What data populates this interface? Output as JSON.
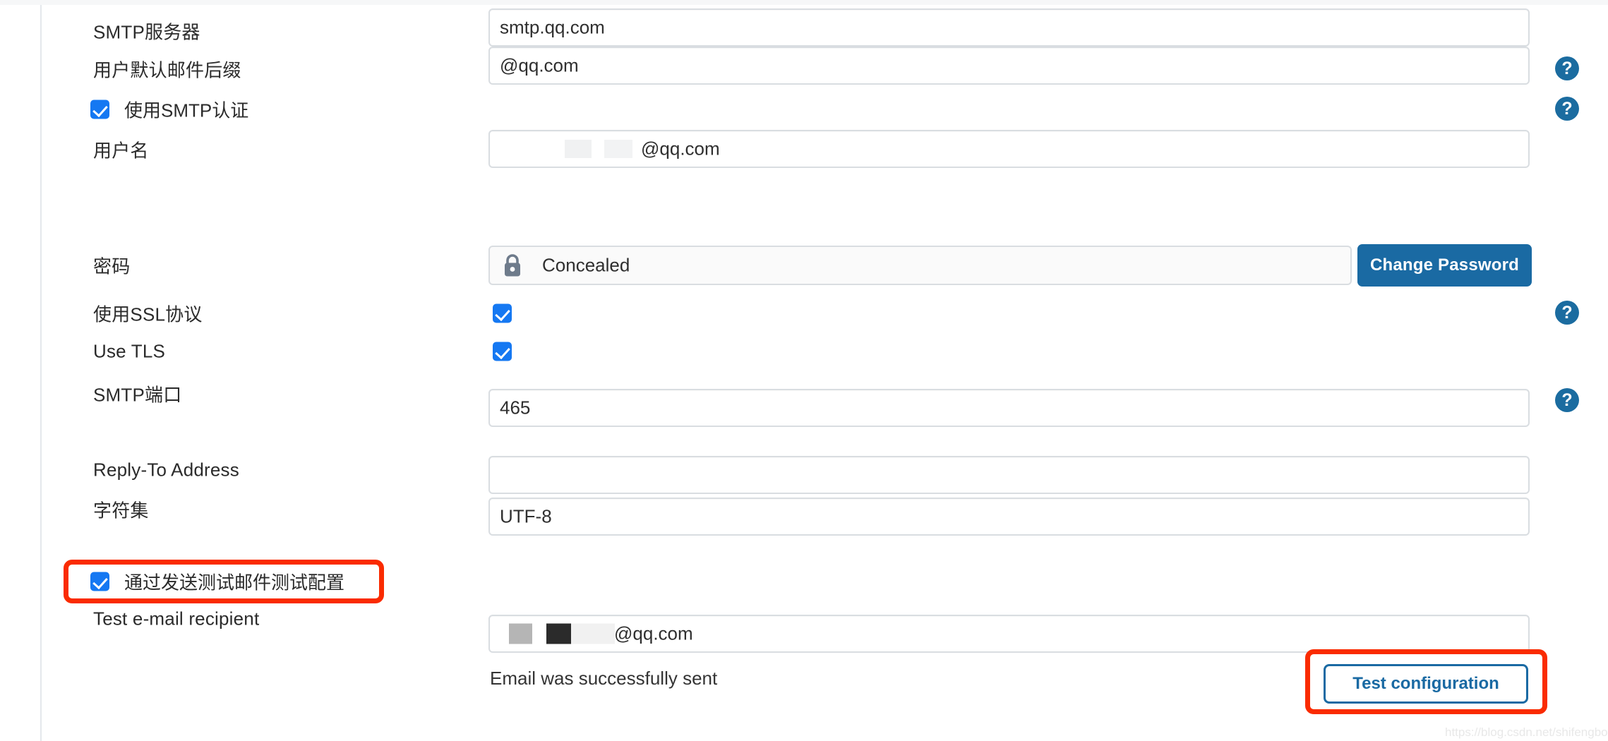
{
  "page": {
    "watermark": "https://blog.csdn.net/shifengboy"
  },
  "form": {
    "rows": [
      {
        "label": "SMTP服务器",
        "value": "smtp.qq.com"
      },
      {
        "label": "用户默认邮件后缀",
        "value": "@qq.com"
      },
      {
        "label": "用户名",
        "value": "@qq.com"
      },
      {
        "label": "密码",
        "value": "Concealed"
      },
      {
        "label": "使用SSL协议",
        "value": ""
      },
      {
        "label": "Use TLS",
        "value": ""
      },
      {
        "label": "SMTP端口",
        "value": "465"
      },
      {
        "label": "Reply-To Address",
        "value": ""
      },
      {
        "label": "字符集",
        "value": "UTF-8"
      },
      {
        "label": "Test e-mail recipient",
        "value": "@qq.com"
      }
    ],
    "checkboxes": {
      "smtp_auth_label": "使用SMTP认证",
      "smtp_auth_checked": true,
      "use_ssl_checked": true,
      "use_tls_checked": true,
      "send_test_label": "通过发送测试邮件测试配置",
      "send_test_checked": true
    },
    "password": {
      "placeholder_text": "Concealed",
      "change_button": "Change Password",
      "lock_icon": "lock-icon"
    },
    "help_icon_glyph": "?",
    "test": {
      "status_message": "Email was successfully sent",
      "button_label": "Test configuration"
    }
  },
  "colors": {
    "checkbox_blue": "#1578f2",
    "button_blue": "#1a6aa3",
    "help_blue": "#1b6ca0",
    "annotation_red": "#fa2b00",
    "field_border": "#d9dde1",
    "lock_gray": "#6e7b8b"
  }
}
